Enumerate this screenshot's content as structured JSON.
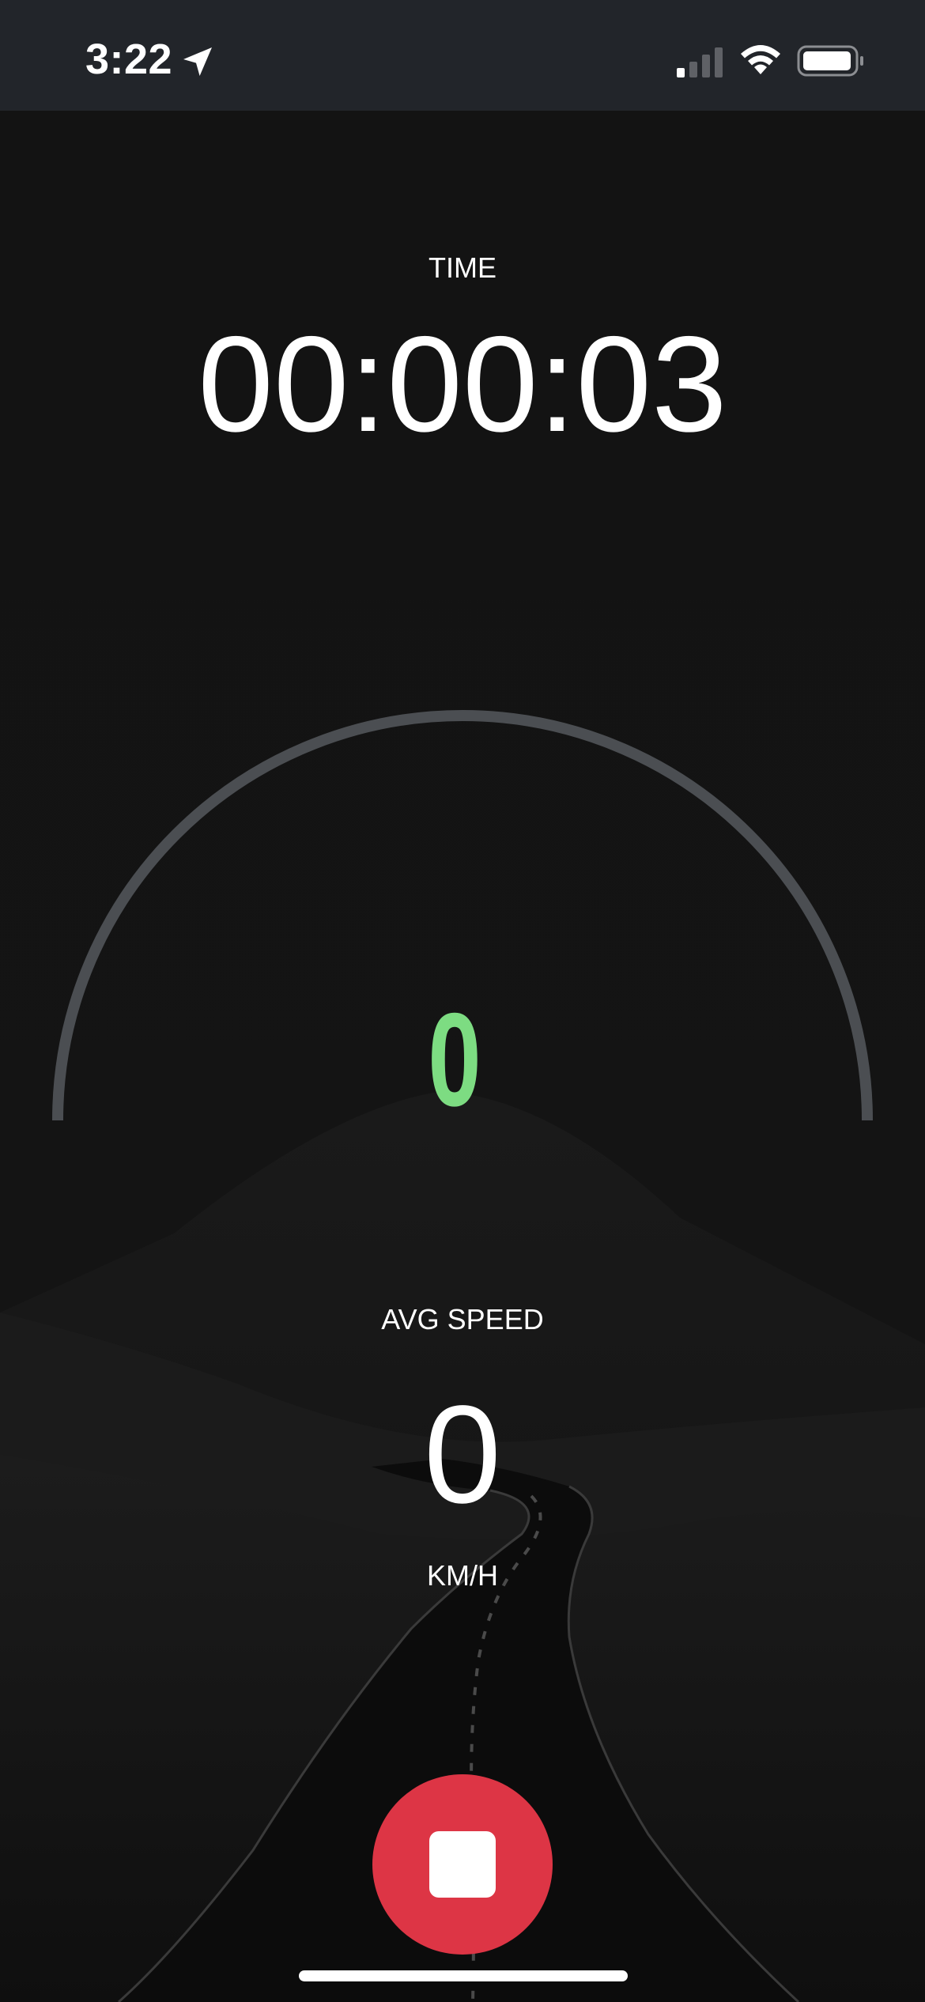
{
  "status_bar": {
    "time": "3:22",
    "location_icon": "location-arrow-icon",
    "signal_icon": "cellular-signal-icon",
    "wifi_icon": "wifi-icon",
    "battery_icon": "battery-icon"
  },
  "timer": {
    "label": "TIME",
    "value": "00:00:03"
  },
  "gauge": {
    "current_speed": "0",
    "speed_fraction": 0,
    "track_color": "#4b4e52",
    "value_color": "#7ddc82"
  },
  "average_speed": {
    "label": "AVG SPEED",
    "value": "0",
    "unit": "KM/H"
  },
  "controls": {
    "stop_icon": "stop-icon",
    "stop_color": "#dd3545"
  }
}
